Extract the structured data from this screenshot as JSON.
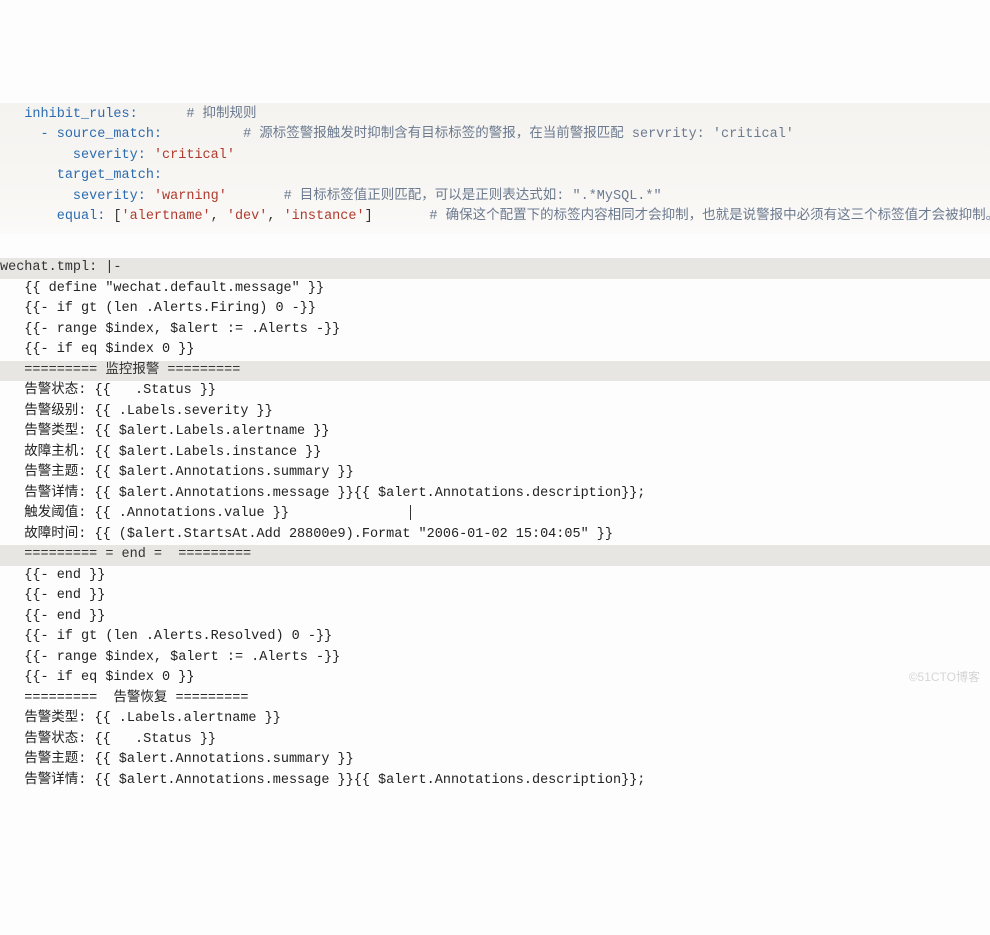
{
  "upper": {
    "l1_key": "inhibit_rules:",
    "l1_cmt": "# 抑制规则",
    "l2_key": "- source_match:",
    "l2_cmt": "# 源标签警报触发时抑制含有目标标签的警报，在当前警报匹配 servrity: 'critical'",
    "l3_key": "severity:",
    "l3_val": "'critical'",
    "l4_key": "target_match:",
    "l5_key": "severity:",
    "l5_val": "'warning'",
    "l5_cmt": "# 目标标签值正则匹配，可以是正则表达式如: \".*MySQL.*\"",
    "l6_key": "equal:",
    "l6_val1": "'alertname'",
    "l6_val2": "'dev'",
    "l6_val3": "'instance'",
    "l6_cmt": "# 确保这个配置下的标签内容相同才会抑制，也就是说警报中必须有这三个标签值才会被抑制。"
  },
  "lower": {
    "l0": "wechat.tmpl: |-",
    "l1": "   {{ define \"wechat.default.message\" }}",
    "l2": "   {{- if gt (len .Alerts.Firing) 0 -}}",
    "l3": "   {{- range $index, $alert := .Alerts -}}",
    "l4": "   {{- if eq $index 0 }}",
    "l5": "   ========= 监控报警 =========",
    "l6": "   告警状态: {{   .Status }}",
    "l7": "   告警级别: {{ .Labels.severity }}",
    "l8": "   告警类型: {{ $alert.Labels.alertname }}",
    "l9": "   故障主机: {{ $alert.Labels.instance }}",
    "l10": "   告警主题: {{ $alert.Annotations.summary }}",
    "l11": "   告警详情: {{ $alert.Annotations.message }}{{ $alert.Annotations.description}};",
    "l12a": "   触发阈值: {{ .Annotations.value }}",
    "l13": "   故障时间: {{ ($alert.StartsAt.Add 28800e9).Format \"2006-01-02 15:04:05\" }}",
    "l14": "   ========= = end =  =========",
    "l15": "   {{- end }}",
    "l16": "   {{- end }}",
    "l17": "   {{- end }}",
    "l18": "   {{- if gt (len .Alerts.Resolved) 0 -}}",
    "l19": "   {{- range $index, $alert := .Alerts -}}",
    "l20": "   {{- if eq $index 0 }}",
    "l21": "   =========  告警恢复 =========",
    "l22": "   告警类型: {{ .Labels.alertname }}",
    "l23": "   告警状态: {{   .Status }}",
    "l24": "   告警主题: {{ $alert.Annotations.summary }}",
    "l25": "   告警详情: {{ $alert.Annotations.message }}{{ $alert.Annotations.description}};"
  },
  "watermark": "©51CTO博客"
}
